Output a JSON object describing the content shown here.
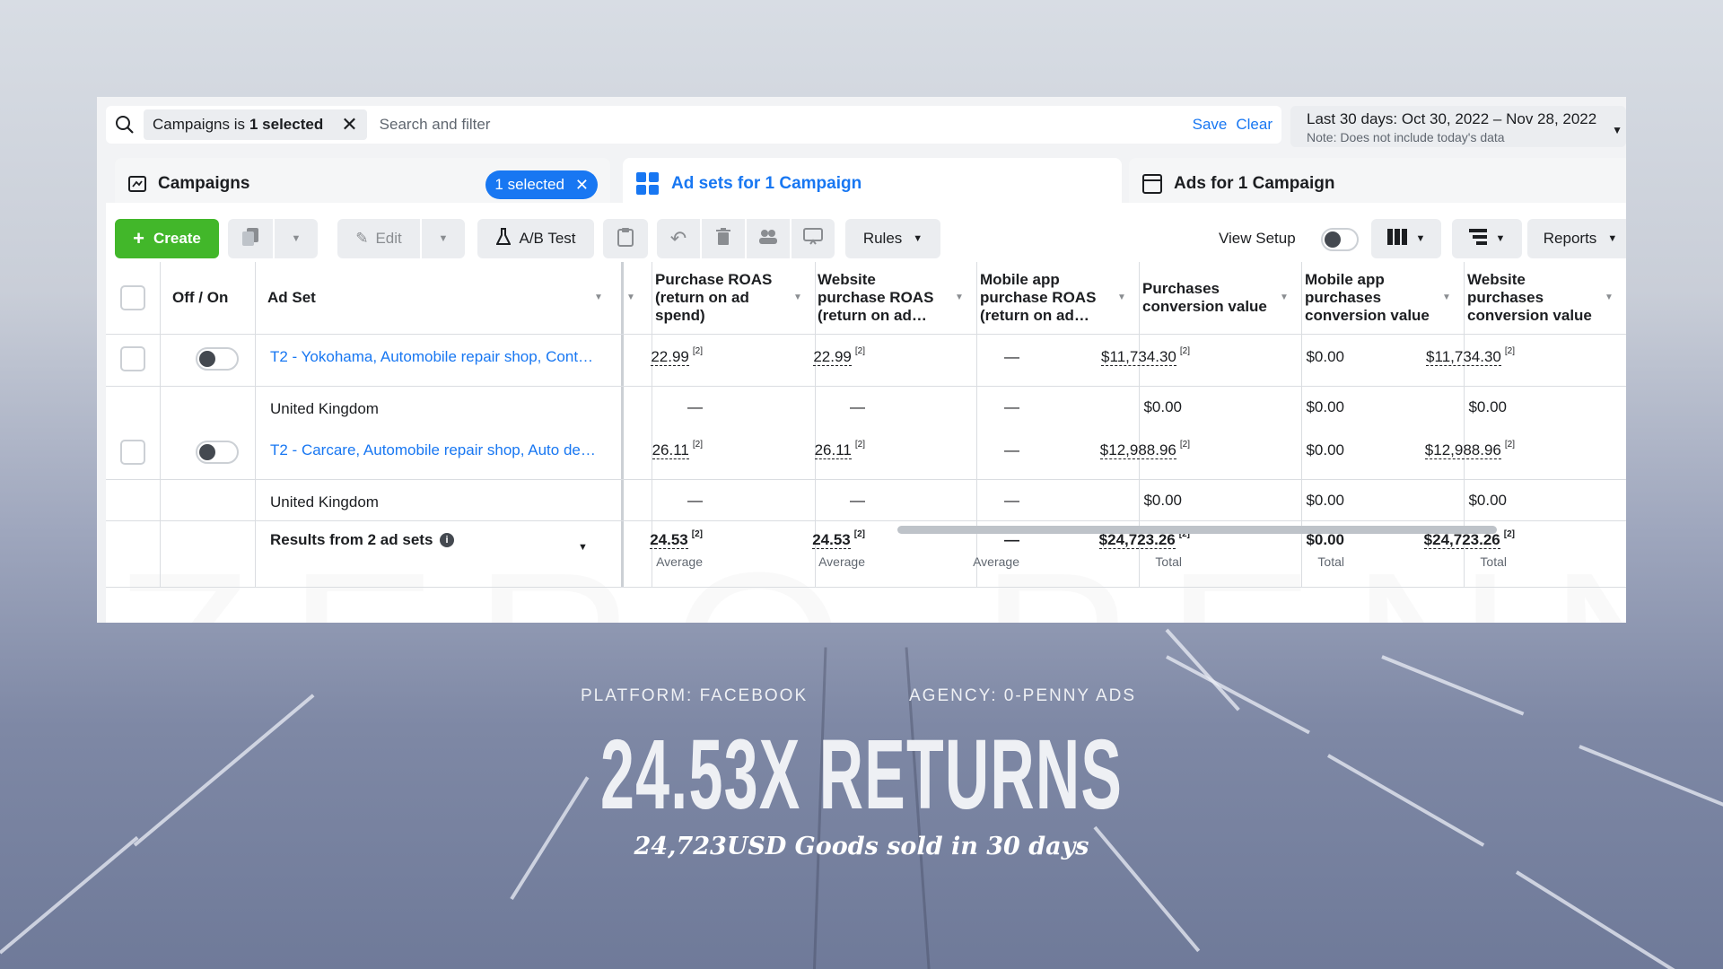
{
  "filter": {
    "chip_prefix": "Campaigns is",
    "chip_bold": "1 selected",
    "search_placeholder": "Search and filter",
    "save": "Save",
    "clear": "Clear"
  },
  "date_range": {
    "label": "Last 30 days: Oct 30, 2022 – Nov 28, 2022",
    "note": "Note: Does not include today's data"
  },
  "tabs": {
    "campaigns": "Campaigns",
    "selected_pill": "1 selected",
    "adsets": "Ad sets for 1 Campaign",
    "ads": "Ads for 1 Campaign"
  },
  "toolbar": {
    "create": "Create",
    "edit": "Edit",
    "ab_test": "A/B Test",
    "rules": "Rules",
    "view_setup": "View Setup",
    "reports": "Reports"
  },
  "table": {
    "headers": {
      "off_on": "Off / On",
      "ad_set": "Ad Set",
      "col1": "Purchase ROAS (return on ad spend)",
      "col2": "Website purchase ROAS (return on ad…",
      "col3": "Mobile app purchase ROAS (return on ad…",
      "col4": "Purchases conversion value",
      "col5": "Mobile app purchases conversion value",
      "col6": "Website purchases conversion value"
    },
    "rows": [
      {
        "name": "T2 - Yokohama, Automobile repair shop, Cont…",
        "c1": "22.99",
        "c2": "22.99",
        "c3": "—",
        "c4": "$11,734.30",
        "c5": "$0.00",
        "c6": "$11,734.30"
      },
      {
        "name": "United Kingdom",
        "c1": "—",
        "c2": "—",
        "c3": "—",
        "c4": "$0.00",
        "c5": "$0.00",
        "c6": "$0.00"
      },
      {
        "name": "T2 - Carcare, Automobile repair shop, Auto de…",
        "c1": "26.11",
        "c2": "26.11",
        "c3": "—",
        "c4": "$12,988.96",
        "c5": "$0.00",
        "c6": "$12,988.96"
      },
      {
        "name": "United Kingdom",
        "c1": "—",
        "c2": "—",
        "c3": "—",
        "c4": "$0.00",
        "c5": "$0.00",
        "c6": "$0.00"
      }
    ],
    "footnote": "[2]",
    "results": {
      "label": "Results from 2 ad sets",
      "c1": "24.53",
      "c1_sub": "Average",
      "c2": "24.53",
      "c2_sub": "Average",
      "c3": "—",
      "c3_sub": "Average",
      "c4": "$24,723.26",
      "c4_sub": "Total",
      "c5": "$0.00",
      "c5_sub": "Total",
      "c6": "$24,723.26",
      "c6_sub": "Total"
    }
  },
  "watermark": "ZERO PENNY",
  "overlay": {
    "platform": "PLATFORM: FACEBOOK",
    "agency": "AGENCY: 0-PENNY ADS",
    "headline": "24.53X RETURNS",
    "subline": "24,723USD Goods sold in 30 days"
  },
  "colors": {
    "accent": "#1877f2",
    "create": "#42b72a"
  }
}
